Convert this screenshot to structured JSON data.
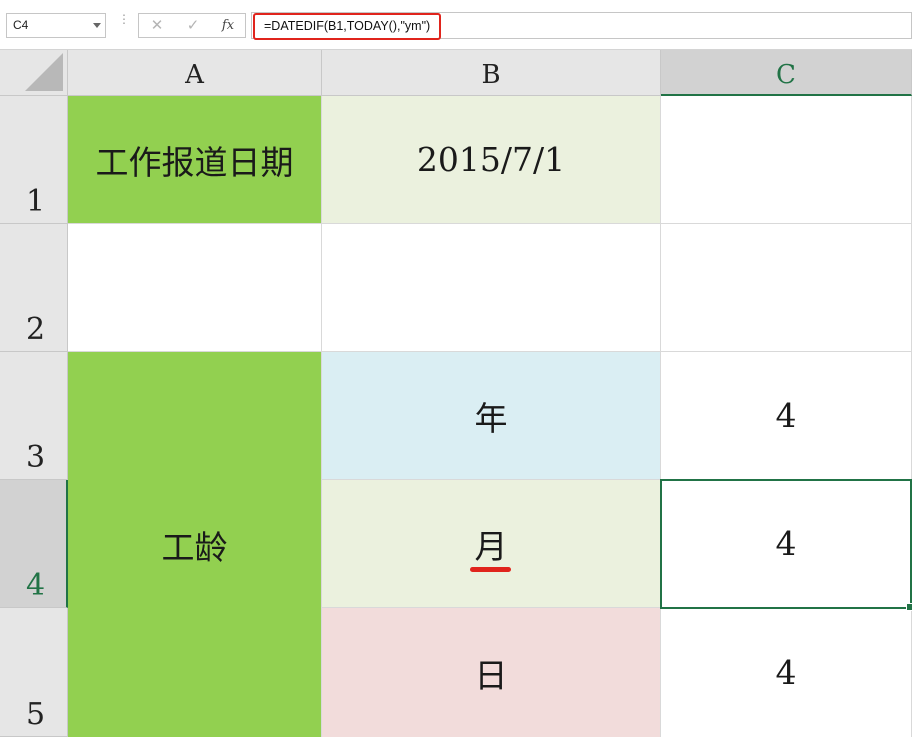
{
  "formula_bar": {
    "name_box": "C4",
    "cancel_icon": "✕",
    "enter_icon": "✓",
    "fx_label": "fx",
    "formula": "=DATEDIF(B1,TODAY(),\"ym\")"
  },
  "columns": [
    "A",
    "B",
    "C"
  ],
  "rows": [
    "1",
    "2",
    "3",
    "4",
    "5"
  ],
  "selection": {
    "active_cell": "C4",
    "active_column": "C",
    "active_row": "4"
  },
  "cells": {
    "A1": "工作报道日期",
    "B1": "2015/7/1",
    "C1": "",
    "A2": "",
    "B2": "",
    "C2": "",
    "A3_A5_merged": "工龄",
    "B3": "年",
    "C3": "4",
    "B4": "月",
    "C4": "4",
    "B5": "日",
    "C5": "4"
  },
  "colors": {
    "green_fill": "#92d050",
    "beige_fill": "#ebf1de",
    "blue_fill": "#daeef3",
    "pink_fill": "#f2dcdb",
    "selection_accent": "#217346",
    "annotation_red": "#e0241c"
  }
}
